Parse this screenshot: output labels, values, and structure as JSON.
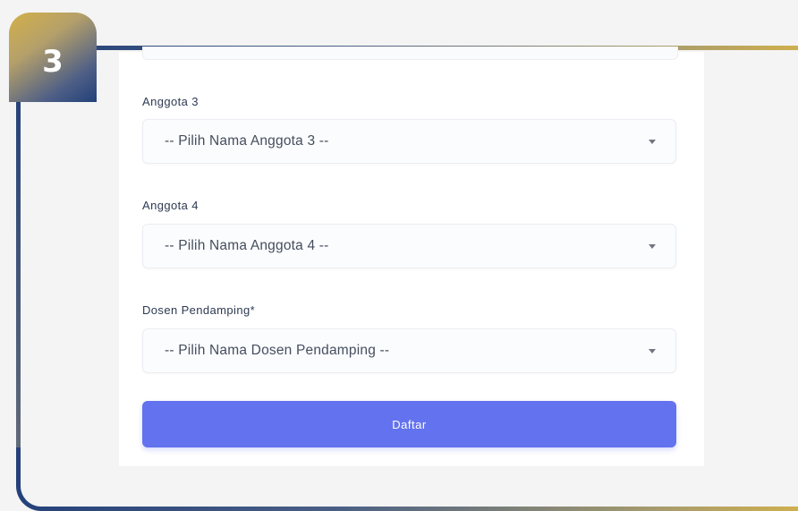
{
  "step": {
    "number": "3"
  },
  "form": {
    "fields": [
      {
        "label": "Anggota 3",
        "value": "-- Pilih Nama Anggota 3 --"
      },
      {
        "label": "Anggota 4",
        "value": "-- Pilih Nama Anggota 4 --"
      },
      {
        "label": "Dosen Pendamping*",
        "value": "-- Pilih Nama Dosen Pendamping --"
      }
    ],
    "submit_label": "Daftar"
  },
  "colors": {
    "accent": "#6372ee",
    "badge_gold": "#d3b049",
    "badge_navy": "#22417a"
  },
  "icons": {
    "select_caret": "chevron-down-icon"
  }
}
